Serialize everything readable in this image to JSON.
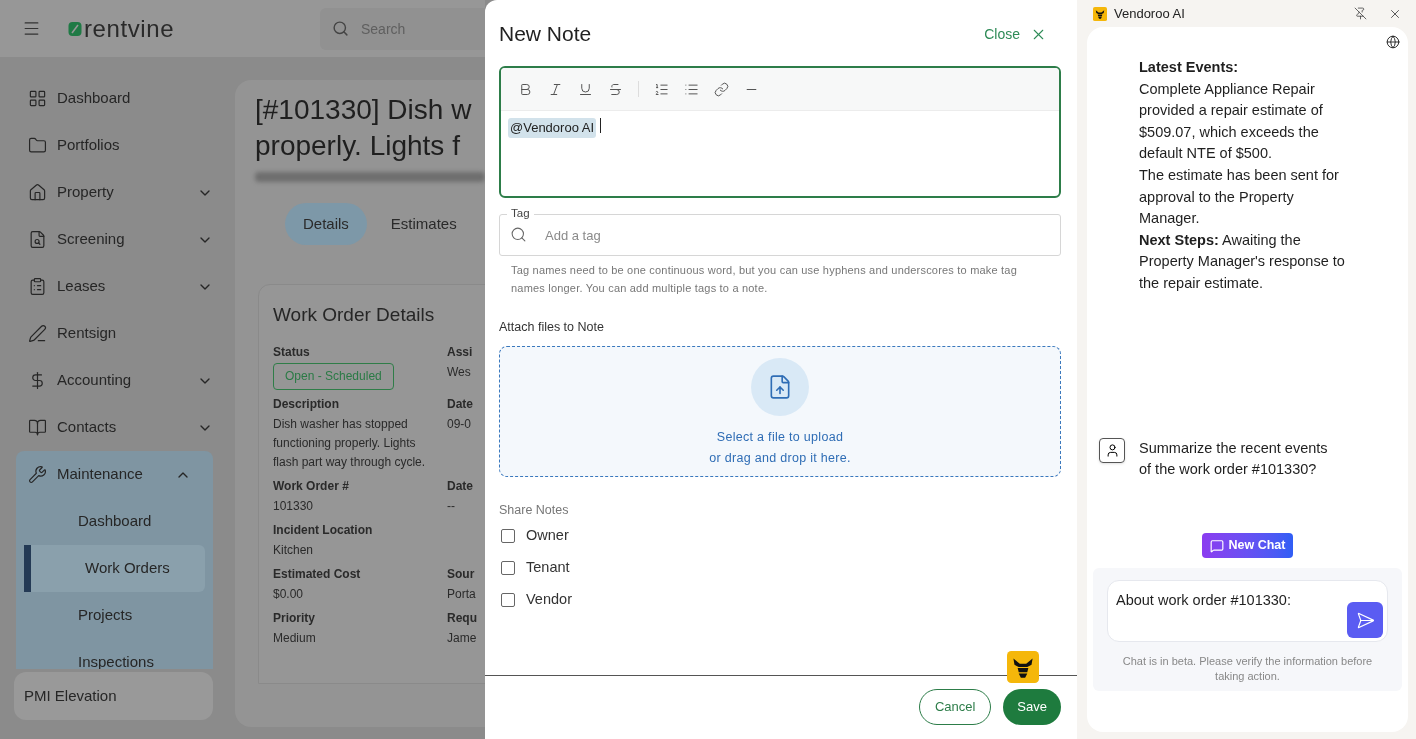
{
  "app": {
    "logo": "rentvine",
    "search": {
      "placeholder": "Search"
    }
  },
  "sidebar": {
    "items": [
      {
        "label": "Dashboard"
      },
      {
        "label": "Portfolios"
      },
      {
        "label": "Property",
        "expanded": false
      },
      {
        "label": "Screening",
        "expanded": false
      },
      {
        "label": "Leases",
        "expanded": false
      },
      {
        "label": "Rentsign"
      },
      {
        "label": "Accounting",
        "expanded": false
      },
      {
        "label": "Contacts",
        "expanded": false
      },
      {
        "label": "Maintenance",
        "expanded": true,
        "children": [
          {
            "label": "Dashboard",
            "selected": false
          },
          {
            "label": "Work Orders",
            "selected": true
          },
          {
            "label": "Projects",
            "selected": false
          },
          {
            "label": "Inspections",
            "selected": false
          }
        ]
      }
    ],
    "workspace": "PMI Elevation"
  },
  "work_order": {
    "title_lines": [
      "[#101330] Dish w",
      "properly. Lights f"
    ],
    "tabs": [
      {
        "label": "Details",
        "selected": true
      },
      {
        "label": "Estimates",
        "selected": false
      }
    ],
    "details": {
      "title": "Work Order Details",
      "rows": [
        {
          "left": {
            "label": "Status",
            "value": "Open - Scheduled",
            "kind": "badge"
          },
          "right": {
            "label": "Assi",
            "value": "Wes"
          }
        },
        {
          "left": {
            "label": "Description",
            "value": "Dish washer has stopped functioning properly. Lights flash part way through cycle.",
            "kind": "text"
          },
          "right": {
            "label": "Date",
            "value": "09-0"
          }
        },
        {
          "left": {
            "label": "Work Order #",
            "value": "101330",
            "kind": "text"
          },
          "right": {
            "label": "Date",
            "value": "--"
          }
        },
        {
          "left": {
            "label": "Incident Location",
            "value": "Kitchen",
            "kind": "text"
          }
        },
        {
          "left": {
            "label": "Estimated Cost",
            "value": "$0.00",
            "kind": "text"
          },
          "right": {
            "label": "Sour",
            "value": "Porta"
          }
        },
        {
          "left": {
            "label": "Priority",
            "value": "Medium",
            "kind": "text"
          },
          "right": {
            "label": "Requ",
            "value": "Jame"
          }
        }
      ]
    }
  },
  "note_modal": {
    "title": "New Note",
    "close": "Close",
    "editor": {
      "mention": "@Vendoroo AI"
    },
    "tag": {
      "label": "Tag",
      "placeholder": "Add a tag",
      "hint": "Tag names need to be one continuous word, but you can use hyphens and underscores to make tag names longer. You can add multiple tags to a note."
    },
    "attach": {
      "label": "Attach files to Note",
      "lines": [
        "Select a file to upload",
        "or drag and drop it here."
      ]
    },
    "share": {
      "label": "Share Notes",
      "options": [
        {
          "label": "Owner",
          "checked": false
        },
        {
          "label": "Tenant",
          "checked": false
        },
        {
          "label": "Vendor",
          "checked": false
        }
      ]
    },
    "buttons": {
      "cancel": "Cancel",
      "save": "Save"
    }
  },
  "chat": {
    "title": "Vendoroo AI",
    "messages": [
      {
        "kind": "assistant",
        "heading": "Latest Events:",
        "paragraphs": [
          "Complete Appliance Repair provided a repair estimate of $509.07, which exceeds the default NTE of $500.",
          "The estimate has been sent for approval to the Property Manager.",
          "**Next Steps:** Awaiting the Property Manager's response to the repair estimate."
        ]
      },
      {
        "kind": "user",
        "text": "Summarize the recent events of the work order #101330?"
      }
    ],
    "new_chat": "New Chat",
    "input": {
      "value": "About work order #101330:"
    },
    "disclaimer": "Chat is in beta. Please verify the information before taking action."
  }
}
